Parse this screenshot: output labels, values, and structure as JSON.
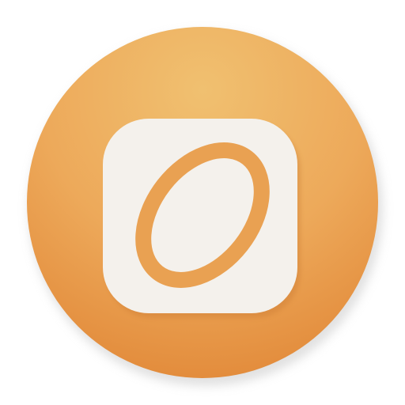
{
  "icon": {
    "semantic": "ring-icon",
    "colors": {
      "disc_top": "#f0c070",
      "disc_mid": "#eda95a",
      "disc_bottom": "#e28a3a",
      "rim_shadow": "#c9c9c9",
      "tile_fill": "#f4f1ec",
      "ring_stroke": "#e9a152"
    }
  }
}
